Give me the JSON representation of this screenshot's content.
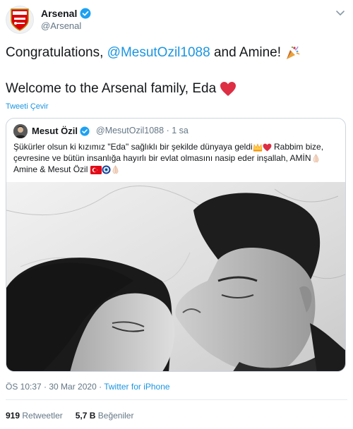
{
  "author": {
    "name": "Arsenal",
    "handle": "@Arsenal"
  },
  "tweet": {
    "line1_pre": "Congratulations, ",
    "line1_mention": "@MesutOzil1088",
    "line1_post": " and Amine! ",
    "line2": "Welcome to the Arsenal family, Eda ",
    "translate_label": "Tweeti Çevir"
  },
  "quoted": {
    "name": "Mesut Özil",
    "handle": "@MesutOzil1088",
    "separator": "·",
    "time": "1 sa",
    "text_line1": "Şükürler olsun ki kızımız \"Eda\" sağlıklı bir şekilde dünyaya geldi",
    "text_line1_post": " Rabbim bize,",
    "text_line2": "çevresine ve bütün insanlığa hayırlı bir evlat olmasını nasip eder inşallah, AMİN",
    "text_line3": "Amine & Mesut Özil"
  },
  "meta": {
    "time": "ÖS 10:37 · 30 Mar 2020 · ",
    "source": "Twitter for iPhone"
  },
  "stats": {
    "retweets_count": "919",
    "retweets_label": "Retweetler",
    "likes_count": "5,7 B",
    "likes_label": "Beğeniler"
  },
  "colors": {
    "link": "#1b95e0",
    "verified": "#1da1f2",
    "text": "#14171a",
    "muted": "#657786"
  },
  "icons": [
    "arsenal-crest-icon",
    "verified-badge-icon",
    "chevron-down-icon",
    "party-popper-icon",
    "red-heart-icon",
    "crown-icon",
    "praying-hands-icon",
    "turkey-flag-icon",
    "evil-eye-icon"
  ]
}
